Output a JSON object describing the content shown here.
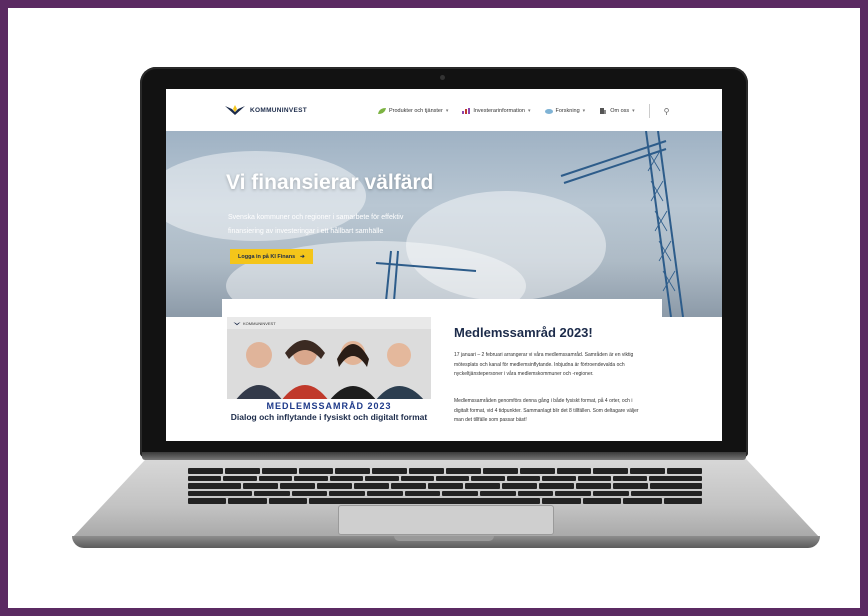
{
  "site": {
    "logo_text": "KOMMUNINVEST",
    "nav": [
      {
        "label": "Produkter och tjänster",
        "icon": "leaf-icon"
      },
      {
        "label": "Investerarinformation",
        "icon": "bar-chart-icon"
      },
      {
        "label": "Forskning",
        "icon": "cloud-icon"
      },
      {
        "label": "Om oss",
        "icon": "building-icon"
      }
    ],
    "search_icon": "search-icon"
  },
  "hero": {
    "title": "Vi finansierar välfärd",
    "subtitle_line1": "Svenska kommuner och regioner i samarbete för effektiv",
    "subtitle_line2": "finansiering av investeringar i ett hållbart samhälle",
    "button_label": "Logga in på KI Finans",
    "button_icon": "arrow-right-icon"
  },
  "promo": {
    "logo_text": "KOMMUNINVEST",
    "title": "MEDLEMSSAMRÅD 2023",
    "subtitle": "Dialog och inflytande i fysiskt och digitalt format"
  },
  "article": {
    "title": "Medlemssamråd 2023!",
    "p1": "17 januari – 2 februari arrangerar vi våra medlemssamråd. Samråden är en viktig mötesplats och kanal för medlemsinflytande. Inbjudna är förtroendevalda och nyckeltjänstepersoner i våra medlemskommuner och -regioner.",
    "p2": "Medlemssamråden genomförs denna gång i både fysiskt format, på 4 orter, och i digitalt format, vid 4 tidpunkter. Sammanlagt blir det 8 tillfällen. Som deltagare väljer man det tillfälle som passar bäst!"
  },
  "colors": {
    "background": "#5b2a62",
    "accent_yellow": "#f4c51a",
    "navy": "#1c2b4a",
    "promo_blue": "#1e3a8a"
  }
}
